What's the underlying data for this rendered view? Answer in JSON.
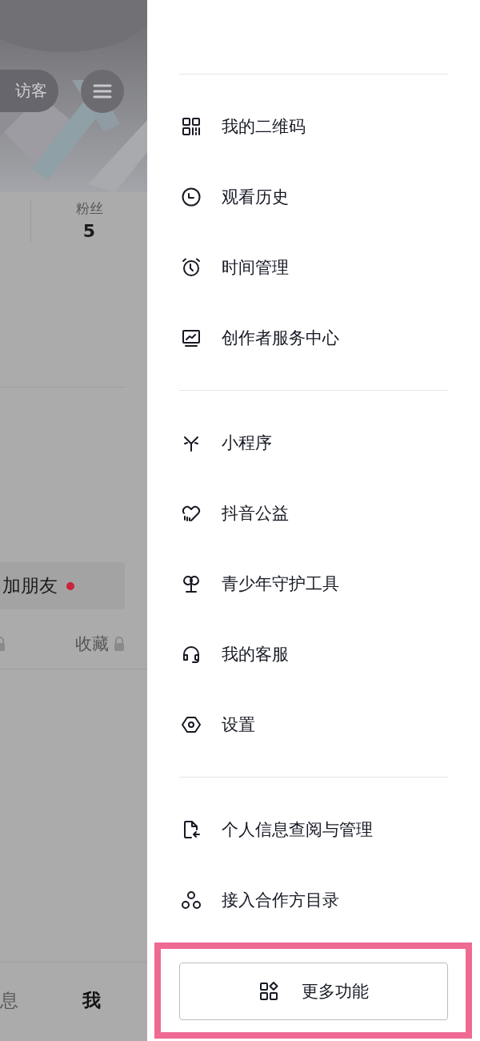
{
  "profile": {
    "visitor_button": "访客",
    "stats": [
      {
        "label": "粉丝",
        "value": "5"
      }
    ],
    "add_friends": {
      "label": "加朋友",
      "badge": true
    },
    "tabs": [
      {
        "locked": true
      },
      {
        "label": "收藏",
        "locked": true
      }
    ],
    "bottom_nav": [
      {
        "label": "息",
        "selected": false
      },
      {
        "label": "我",
        "selected": true
      }
    ]
  },
  "drawer": {
    "groups": [
      [
        {
          "label": "我的二维码"
        },
        {
          "label": "观看历史"
        },
        {
          "label": "时间管理"
        },
        {
          "label": "创作者服务中心"
        }
      ],
      [
        {
          "label": "小程序"
        },
        {
          "label": "抖音公益"
        },
        {
          "label": "青少年守护工具"
        },
        {
          "label": "我的客服"
        },
        {
          "label": "设置"
        }
      ],
      [
        {
          "label": "个人信息查阅与管理"
        },
        {
          "label": "接入合作方目录"
        }
      ]
    ],
    "more_button": {
      "label": "更多功能",
      "highlighted": true
    }
  }
}
